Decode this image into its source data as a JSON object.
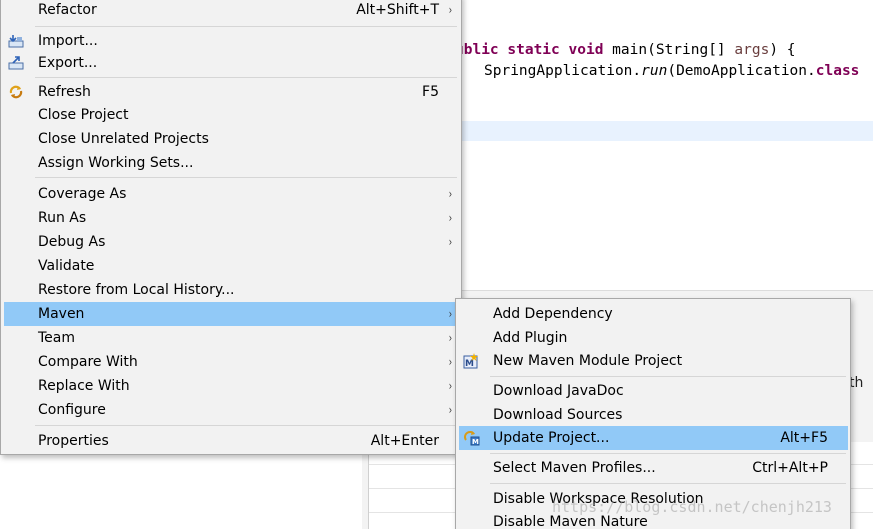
{
  "editor": {
    "line1": {
      "kw1": "ublic",
      "kw2": "static",
      "kw3": "void",
      "rest1": " main(String[] ",
      "param": "args",
      "rest2": ") {"
    },
    "line2": {
      "pre": "SpringApplication.",
      "method": "run",
      "mid": "(DemoApplication.",
      "kw": "class"
    }
  },
  "panel": {
    "fragment": "th"
  },
  "context_menu": {
    "items": [
      {
        "label": "Refactor",
        "accel": "Alt+Shift+T",
        "submenu": true
      },
      {
        "label": "Import...",
        "icon": "import-icon"
      },
      {
        "label": "Export...",
        "icon": "export-icon"
      },
      {
        "label": "Refresh",
        "accel": "F5",
        "icon": "refresh-icon"
      },
      {
        "label": "Close Project"
      },
      {
        "label": "Close Unrelated Projects"
      },
      {
        "label": "Assign Working Sets..."
      },
      {
        "label": "Coverage As",
        "submenu": true
      },
      {
        "label": "Run As",
        "submenu": true
      },
      {
        "label": "Debug As",
        "submenu": true
      },
      {
        "label": "Validate"
      },
      {
        "label": "Restore from Local History..."
      },
      {
        "label": "Maven",
        "submenu": true,
        "highlighted": true
      },
      {
        "label": "Team",
        "submenu": true
      },
      {
        "label": "Compare With",
        "submenu": true
      },
      {
        "label": "Replace With",
        "submenu": true
      },
      {
        "label": "Configure",
        "submenu": true
      },
      {
        "label": "Properties",
        "accel": "Alt+Enter"
      }
    ]
  },
  "maven_submenu": {
    "items": [
      {
        "label": "Add Dependency"
      },
      {
        "label": "Add Plugin"
      },
      {
        "label": "New Maven Module Project",
        "icon": "maven-module-icon"
      },
      {
        "label": "Download JavaDoc"
      },
      {
        "label": "Download Sources"
      },
      {
        "label": "Update Project...",
        "accel": "Alt+F5",
        "icon": "update-project-icon",
        "highlighted": true
      },
      {
        "label": "Select Maven Profiles...",
        "accel": "Ctrl+Alt+P"
      },
      {
        "label": "Disable Workspace Resolution"
      },
      {
        "label": "Disable Maven Nature"
      }
    ]
  },
  "chevron": "›",
  "watermark": "https://blog.csdn.net/chenjh213",
  "colors": {
    "highlight": "#91c9f7",
    "menu_bg": "#f2f2f2",
    "keyword": "#7f0055"
  }
}
